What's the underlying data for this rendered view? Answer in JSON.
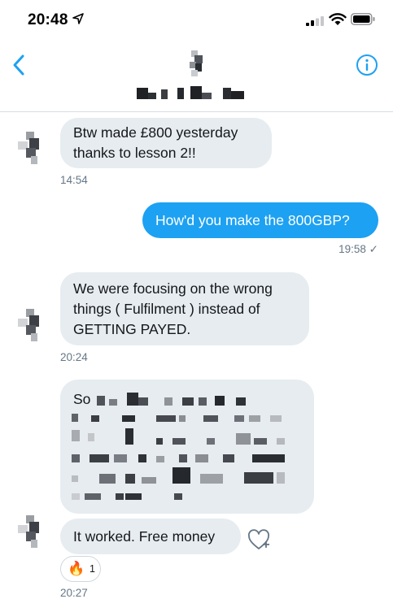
{
  "status_bar": {
    "time": "20:48",
    "icons": [
      "location-arrow-icon",
      "signal-icon",
      "wifi-icon",
      "battery-icon"
    ]
  },
  "header": {
    "icons": [
      "back-chevron-icon",
      "info-icon"
    ],
    "accent": "#1da1f2"
  },
  "messages": [
    {
      "direction": "incoming",
      "lines": [
        "Btw made £800 yesterday",
        "thanks to lesson 2!!"
      ],
      "time": "14:54"
    },
    {
      "direction": "outgoing",
      "lines": [
        "How'd you make the 800GBP?"
      ],
      "time": "19:58 ✓"
    },
    {
      "direction": "incoming",
      "lines": [
        "We were focusing on the wrong",
        "things ( Fulfilment ) instead of",
        "GETTING PAYED."
      ],
      "time": "20:24"
    },
    {
      "direction": "incoming",
      "lines": [
        "So"
      ],
      "note": "rest redacted"
    },
    {
      "direction": "incoming",
      "lines": [
        "It worked. Free money"
      ],
      "time": "20:27",
      "reaction": {
        "emoji": "🔥",
        "count": "1"
      }
    }
  ],
  "colors": {
    "incoming_bubble": "#e6ecf0",
    "outgoing_bubble": "#1da1f2",
    "timestamp": "#657786"
  }
}
